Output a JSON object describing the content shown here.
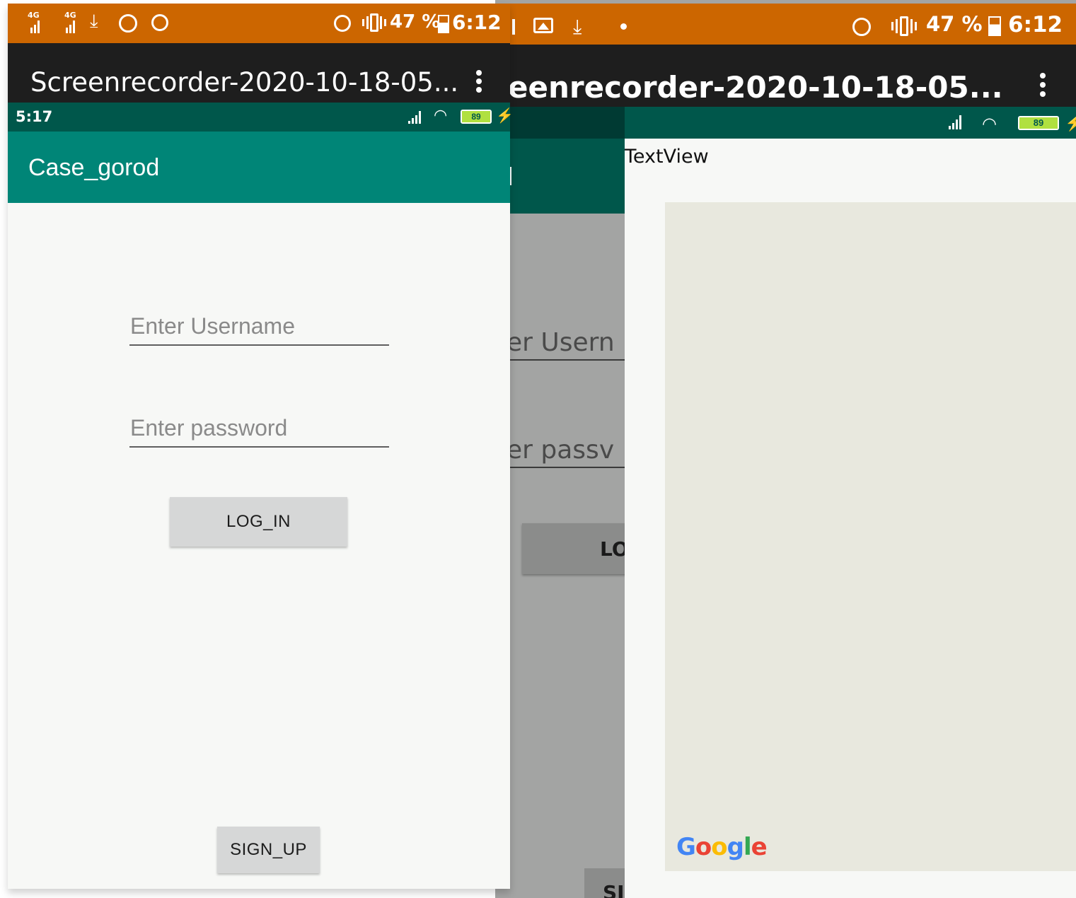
{
  "left_recording": {
    "status_bar": {
      "network_1": "4G",
      "network_2": "4G",
      "battery_percent": "47 %",
      "time": "6:12"
    },
    "video_title": "Screenrecorder-2020-10-18-05...",
    "app": {
      "status_time": "5:17",
      "battery": "89",
      "title": "Case_gorod",
      "username_placeholder": "Enter Username",
      "password_placeholder": "Enter password",
      "login_label": "LOG_IN",
      "signup_label": "SIGN_UP"
    }
  },
  "right_recording": {
    "status_bar": {
      "battery_percent": "47 %",
      "time": "6:12"
    },
    "video_title": "eenrecorder-2020-10-18-05...",
    "app": {
      "battery": "89",
      "username_partial": "er Usern",
      "password_partial": "er passv",
      "login_partial": "LO",
      "signup_partial": "SI",
      "textview_label": "TextView",
      "map_logo": {
        "G": "G",
        "o1": "o",
        "o2": "o",
        "g": "g",
        "l": "l",
        "e": "e"
      }
    }
  },
  "colors": {
    "status_orange": "#cc6600",
    "video_bar": "#1e1e1e",
    "app_teal": "#008577",
    "app_teal_dark": "#00574b",
    "map_bg": "#e8e8de",
    "google_blue": "#4285f4",
    "google_red": "#ea4335",
    "google_yellow": "#fbbc05",
    "google_green": "#34a853"
  }
}
